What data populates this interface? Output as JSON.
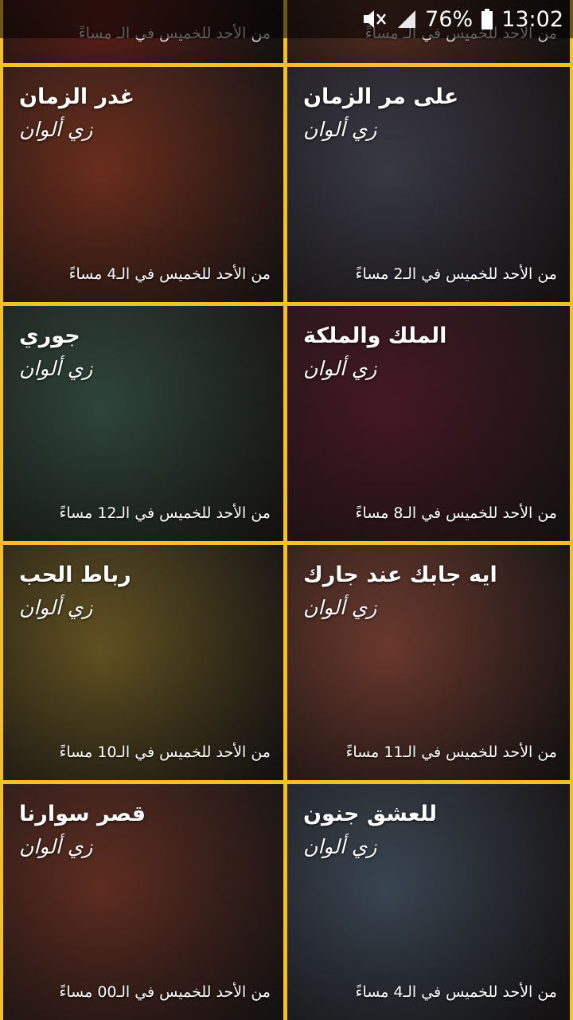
{
  "status_bar": {
    "battery": "76%",
    "time": "13:02"
  },
  "shows": [
    {
      "title": "",
      "channel": "",
      "schedule": "من الأحد للخميس في الـ مساءً",
      "partial": true,
      "color": "#7a2a20"
    },
    {
      "title": "",
      "channel": "",
      "schedule": "من الأحد للخميس في الـ مساءً",
      "partial": true,
      "color": "#6b3a2a"
    },
    {
      "title": "غدر الزمان",
      "channel": "زي ألوان",
      "schedule": "من الأحد للخميس في الـ4 مساءً",
      "color": "#8a3b24"
    },
    {
      "title": "على مر الزمان",
      "channel": "زي ألوان",
      "schedule": "من الأحد للخميس في الـ2 مساءً",
      "color": "#4a4a58"
    },
    {
      "title": "جوري",
      "channel": "زي ألوان",
      "schedule": "من الأحد للخميس في الـ12 مساءً",
      "color": "#3c5a4a"
    },
    {
      "title": "الملك والملكة",
      "channel": "زي ألوان",
      "schedule": "من الأحد للخميس في الـ8 مساءً",
      "color": "#5a1f2e"
    },
    {
      "title": "رباط الحب",
      "channel": "زي ألوان",
      "schedule": "من الأحد للخميس في الـ10 مساءً",
      "color": "#7d6a2a"
    },
    {
      "title": "ايه جابك عند جارك",
      "channel": "زي ألوان",
      "schedule": "من الأحد للخميس في الـ11 مساءً",
      "color": "#8a4a3a"
    },
    {
      "title": "قصر سوارنا",
      "channel": "زي ألوان",
      "schedule": "من الأحد للخميس في الـ00 مساءً",
      "color": "#7a3a2a"
    },
    {
      "title": "للعشق جنون",
      "channel": "زي ألوان",
      "schedule": "من الأحد للخميس في الـ4 مساءً",
      "color": "#4a5a6a"
    }
  ]
}
